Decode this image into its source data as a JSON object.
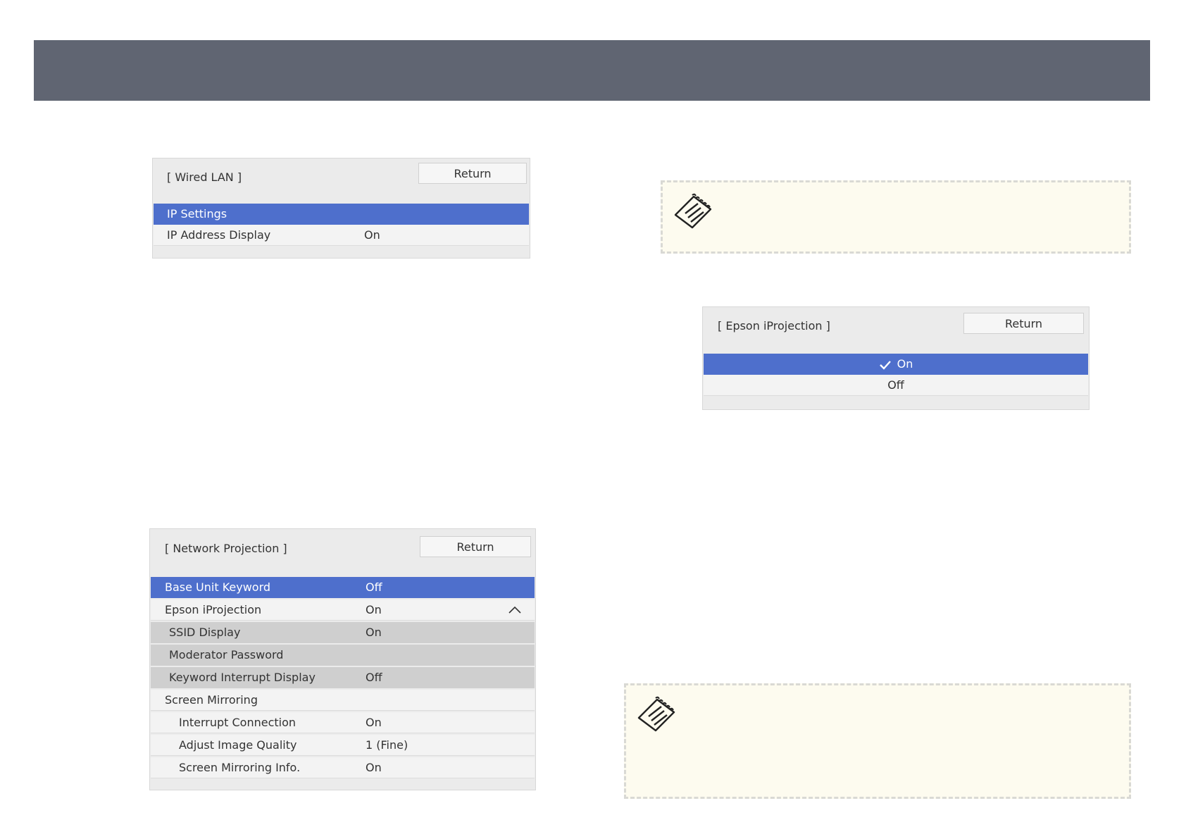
{
  "wired_lan_menu": {
    "title": "[ Wired LAN ]",
    "return_label": "Return",
    "rows": [
      {
        "label": "IP Settings",
        "value": ""
      },
      {
        "label": "IP Address Display",
        "value": "On"
      }
    ]
  },
  "iprojection_menu": {
    "title": "[ Epson iProjection ]",
    "return_label": "Return",
    "options": [
      {
        "label": "On",
        "checked": true
      },
      {
        "label": "Off",
        "checked": false
      }
    ]
  },
  "network_projection_menu": {
    "title": "[ Network Projection ]",
    "return_label": "Return",
    "rows": [
      {
        "label": "Base Unit Keyword",
        "value": "Off"
      },
      {
        "label": "Epson iProjection",
        "value": "On"
      },
      {
        "label": "SSID Display",
        "value": "On"
      },
      {
        "label": "Moderator Password",
        "value": ""
      },
      {
        "label": "Keyword Interrupt Display",
        "value": "Off"
      },
      {
        "label": "Screen Mirroring",
        "value": ""
      },
      {
        "label": "Interrupt Connection",
        "value": "On"
      },
      {
        "label": "Adjust Image Quality",
        "value": "1 (Fine)"
      },
      {
        "label": "Screen Mirroring Info.",
        "value": "On"
      }
    ]
  },
  "icons": {
    "note": "note-pad-icon",
    "check": "checkmark-icon",
    "collapse": "chevron-up-icon"
  },
  "colors": {
    "header_bar": "#606572",
    "selection": "#4e6fcc",
    "note_background": "#fdfbef"
  }
}
